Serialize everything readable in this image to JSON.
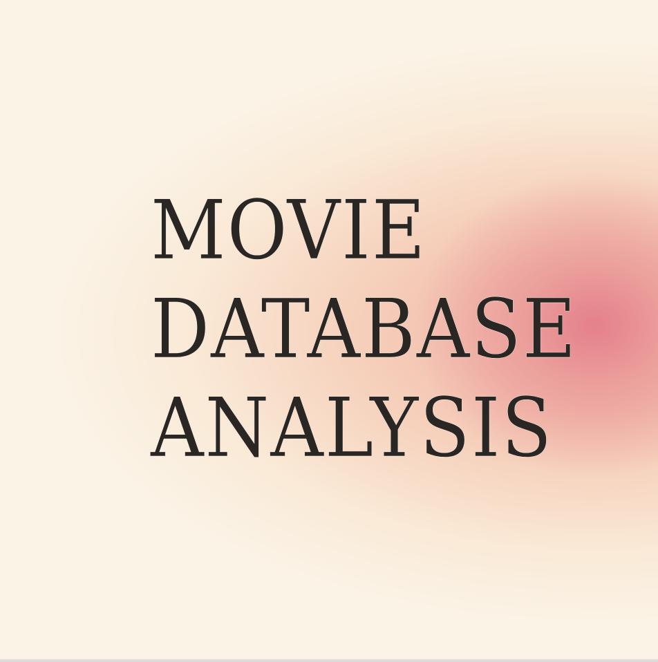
{
  "slide": {
    "title_lines": [
      "MOVIE",
      "DATABASE",
      "ANALYSIS"
    ]
  },
  "colors": {
    "background": "#fbf3e6",
    "glow_core": "#e47e8a",
    "glow_mid": "#f3bea5",
    "text": "#2a2624"
  }
}
